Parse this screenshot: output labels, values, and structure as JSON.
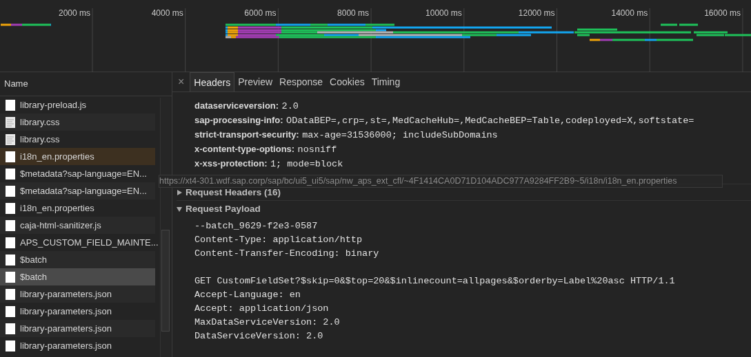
{
  "timeline": {
    "ticks": [
      "2000 ms",
      "4000 ms",
      "6000 ms",
      "8000 ms",
      "10000 ms",
      "12000 ms",
      "14000 ms",
      "16000 ms"
    ]
  },
  "requests_panel": {
    "column_header": "Name",
    "rows": [
      {
        "name": "library-preload.js",
        "kind": "file",
        "selected": false,
        "highlighted": false
      },
      {
        "name": "library.css",
        "kind": "stylesheet",
        "selected": false,
        "highlighted": false
      },
      {
        "name": "library.css",
        "kind": "stylesheet",
        "selected": false,
        "highlighted": false
      },
      {
        "name": "i18n_en.properties",
        "kind": "file",
        "selected": false,
        "highlighted": true
      },
      {
        "name": "$metadata?sap-language=EN...",
        "kind": "file",
        "selected": false,
        "highlighted": false
      },
      {
        "name": "$metadata?sap-language=EN...",
        "kind": "file",
        "selected": false,
        "highlighted": false
      },
      {
        "name": "i18n_en.properties",
        "kind": "file",
        "selected": false,
        "highlighted": false
      },
      {
        "name": "caja-html-sanitizer.js",
        "kind": "file",
        "selected": false,
        "highlighted": false
      },
      {
        "name": "APS_CUSTOM_FIELD_MAINTE...",
        "kind": "file",
        "selected": false,
        "highlighted": false
      },
      {
        "name": "$batch",
        "kind": "file",
        "selected": false,
        "highlighted": false
      },
      {
        "name": "$batch",
        "kind": "file",
        "selected": true,
        "highlighted": false
      },
      {
        "name": "library-parameters.json",
        "kind": "file",
        "selected": false,
        "highlighted": false
      },
      {
        "name": "library-parameters.json",
        "kind": "file",
        "selected": false,
        "highlighted": false
      },
      {
        "name": "library-parameters.json",
        "kind": "file",
        "selected": false,
        "highlighted": false
      },
      {
        "name": "library-parameters.json",
        "kind": "file",
        "selected": false,
        "highlighted": false
      }
    ]
  },
  "details": {
    "close_glyph": "×",
    "tabs": [
      {
        "label": "Headers",
        "selected": true
      },
      {
        "label": "Preview",
        "selected": false
      },
      {
        "label": "Response",
        "selected": false
      },
      {
        "label": "Cookies",
        "selected": false
      },
      {
        "label": "Timing",
        "selected": false
      }
    ],
    "response_headers": [
      {
        "key": "dataserviceversion:",
        "value": "2.0"
      },
      {
        "key": "sap-processing-info:",
        "value": "ODataBEP=,crp=,st=,MedCacheHub=,MedCacheBEP=Table,codeployed=X,softstate="
      },
      {
        "key": "strict-transport-security:",
        "value": "max-age=31536000; includeSubDomains"
      },
      {
        "key": "x-content-type-options:",
        "value": "nosniff"
      },
      {
        "key": "x-xss-protection:",
        "value": "1; mode=block"
      }
    ],
    "sections": [
      {
        "title": "Request Headers (16)",
        "expanded": false
      },
      {
        "title": "Request Payload",
        "expanded": true
      }
    ],
    "payload_blocks": [
      [
        "--batch_9629-f2e3-0587",
        "Content-Type: application/http",
        "Content-Transfer-Encoding: binary"
      ],
      [
        "GET CustomFieldSet?$skip=0&$top=20&$inlinecount=allpages&$orderby=Label%20asc HTTP/1.1",
        "Accept-Language: en",
        "Accept: application/json",
        "MaxDataServiceVersion: 2.0",
        "DataServiceVersion: 2.0"
      ]
    ]
  },
  "tooltip": {
    "text": "https://xt4-301.wdf.sap.corp/sap/bc/ui5_ui5/sap/nw_aps_ext_cfl/~4F1414CA0D71D104ADC977A9284FF2B9~5/i18n/i18n_en.properties"
  }
}
